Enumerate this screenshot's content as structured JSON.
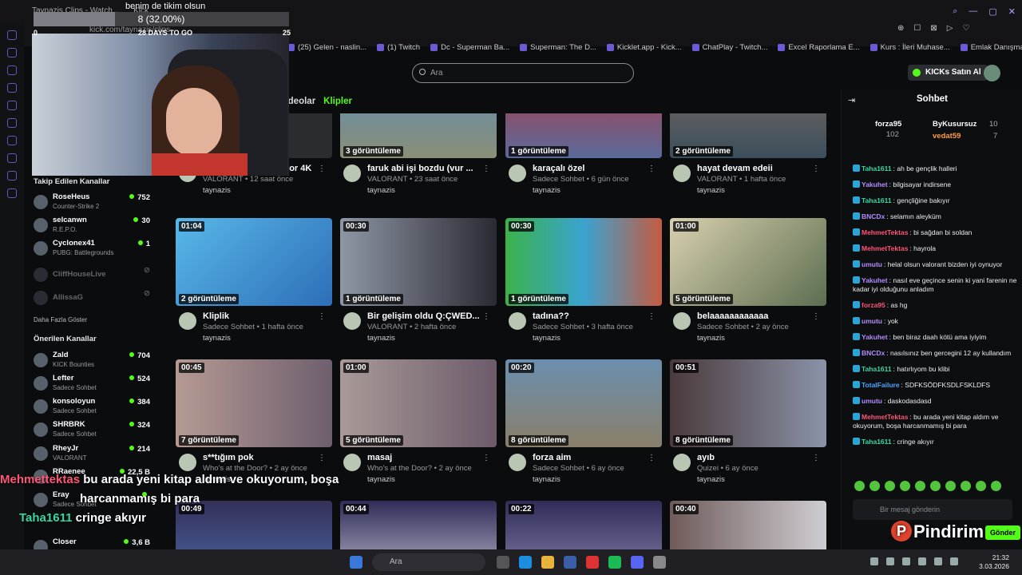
{
  "browser": {
    "url": "kick.com/taynazis/clips",
    "tabs": [
      "Taynazis Clips - Watch...",
      "Kick"
    ],
    "bookmarks": [
      "(25) Gelen - naslin...",
      "(1) Twitch",
      "Dc - Superman Ba...",
      "Superman: The D...",
      "Kicklet.app - Kick...",
      "ChatPlay - Twitch...",
      "Excel Raporlama E...",
      "Kurs : İleri Muhase...",
      "Emlak Danışmanlı..."
    ]
  },
  "goal": {
    "title": "benim de tikim olsun",
    "progress_text": "8 (32.00%)",
    "fraction": 0.32,
    "min": "0",
    "days_left": "28 DAYS TO GO",
    "max": "25"
  },
  "header": {
    "search_placeholder": "Ara",
    "buy_kicks": "KICKs Satın Al"
  },
  "tabs": {
    "videos": "Videolar",
    "clips": "Klipler"
  },
  "sidebar": {
    "followed_title": "Takip Edilen Kanallar",
    "followed": [
      {
        "name": "RoseHeus",
        "game": "Counter-Strike 2",
        "viewers": "752"
      },
      {
        "name": "selcanwn",
        "game": "R.E.P.O.",
        "viewers": "30"
      },
      {
        "name": "Cyclonex41",
        "game": "PUBG: Battlegrounds",
        "viewers": "1"
      },
      {
        "name": "CliffHouseLive",
        "game": "",
        "viewers": ""
      },
      {
        "name": "AllissaG",
        "game": "",
        "viewers": ""
      }
    ],
    "show_more": "Daha Fazla Göster",
    "recommended_title": "Önerilen Kanallar",
    "recommended": [
      {
        "name": "Zald",
        "game": "KICK Bounties",
        "viewers": "704"
      },
      {
        "name": "Lefter",
        "game": "Sadece Sohbet",
        "viewers": "524"
      },
      {
        "name": "konsoloyun",
        "game": "Sadece Sohbet",
        "viewers": "384"
      },
      {
        "name": "SHRBRK",
        "game": "Sadece Sohbet",
        "viewers": "324"
      },
      {
        "name": "RheyJr",
        "game": "VALORANT",
        "viewers": "214"
      },
      {
        "name": "RRaenee",
        "game": "",
        "viewers": "22,5 B"
      },
      {
        "name": "Eray",
        "game": "Sadece Sohbet",
        "viewers": ""
      },
      {
        "name": "",
        "game": "",
        "viewers": ""
      },
      {
        "name": "Closer",
        "game": "",
        "viewers": "3,6 B"
      }
    ]
  },
  "clips": [
    {
      "duration": "",
      "views": "",
      "title": "taynaz skini gösteriyor 4K",
      "meta": "VALORANT • 12 saat önce",
      "author": "taynazis"
    },
    {
      "duration": "",
      "views": "3 görüntüleme",
      "title": "faruk abi işi bozdu (vur ...",
      "meta": "VALORANT • 23 saat önce",
      "author": "taynazis"
    },
    {
      "duration": "",
      "views": "1 görüntüleme",
      "title": "karaçalı özel",
      "meta": "Sadece Sohbet • 6 gün önce",
      "author": "taynazis"
    },
    {
      "duration": "",
      "views": "2 görüntüleme",
      "title": "hayat devam edeii",
      "meta": "VALORANT • 1 hafta önce",
      "author": "taynazis"
    },
    {
      "duration": "01:04",
      "views": "2 görüntüleme",
      "title": "Kliplik",
      "meta": "Sadece Sohbet • 1 hafta önce",
      "author": "taynazis"
    },
    {
      "duration": "00:30",
      "views": "1 görüntüleme",
      "title": "Bir gelişim oldu Q:ÇWED...",
      "meta": "VALORANT • 2 hafta önce",
      "author": "taynazis"
    },
    {
      "duration": "00:30",
      "views": "1 görüntüleme",
      "title": "tadına??",
      "meta": "Sadece Sohbet • 3 hafta önce",
      "author": "taynazis"
    },
    {
      "duration": "01:00",
      "views": "5 görüntüleme",
      "title": "belaaaaaaaaaaaa",
      "meta": "Sadece Sohbet • 2 ay önce",
      "author": "taynazis"
    },
    {
      "duration": "00:45",
      "views": "7 görüntüleme",
      "title": "s**tığım pok",
      "meta": "Who's at the Door? • 2 ay önce",
      "author": "taynazis"
    },
    {
      "duration": "01:00",
      "views": "5 görüntüleme",
      "title": "masaj",
      "meta": "Who's at the Door? • 2 ay önce",
      "author": "taynazis"
    },
    {
      "duration": "00:20",
      "views": "8 görüntüleme",
      "title": "forza aim",
      "meta": "Sadece Sohbet • 6 ay önce",
      "author": "taynazis"
    },
    {
      "duration": "00:51",
      "views": "8 görüntüleme",
      "title": "ayıb",
      "meta": "Quizei • 6 ay önce",
      "author": "taynazis"
    },
    {
      "duration": "00:49",
      "views": "",
      "title": "",
      "meta": "",
      "author": ""
    },
    {
      "duration": "00:44",
      "views": "",
      "title": "",
      "meta": "",
      "author": ""
    },
    {
      "duration": "00:22",
      "views": "",
      "title": "",
      "meta": "",
      "author": ""
    },
    {
      "duration": "00:40",
      "views": "",
      "title": "",
      "meta": "",
      "author": ""
    }
  ],
  "chat": {
    "title": "Sohbet",
    "leaderboard": [
      {
        "name": "forza95",
        "score": "102"
      },
      {
        "name": "ByKusursuz",
        "score": "10"
      },
      {
        "name": "vedat59",
        "score": "7"
      }
    ],
    "messages": [
      {
        "user": "Taha1611",
        "color": "#36d8a2",
        "text": "ah be gençlik halleri"
      },
      {
        "user": "Yakuhet",
        "color": "#b18cff",
        "text": "bilgisayar indirsene"
      },
      {
        "user": "Taha1611",
        "color": "#36d8a2",
        "text": "gençliğine bakıyır"
      },
      {
        "user": "BNCDx",
        "color": "#b18cff",
        "text": "selamın aleyküm"
      },
      {
        "user": "MehmetTektas",
        "color": "#ff5577",
        "text": "bi sağdan bi soldan"
      },
      {
        "user": "MehmetTektas",
        "color": "#ff5577",
        "text": "hayrola"
      },
      {
        "user": "umutu",
        "color": "#b18cff",
        "text": "helal olsun valorant bizden iyi oynuyor"
      },
      {
        "user": "Yakuhet",
        "color": "#b18cff",
        "text": "nasıl eve geçince senin ki yani farenin ne kadar iyi olduğunu anladım"
      },
      {
        "user": "forza95",
        "color": "#ff5577",
        "text": "as hg"
      },
      {
        "user": "umutu",
        "color": "#b18cff",
        "text": "yok"
      },
      {
        "user": "Yakuhet",
        "color": "#b18cff",
        "text": "ben biraz daah kötü ama iyiyim"
      },
      {
        "user": "BNCDx",
        "color": "#b18cff",
        "text": "nasılsınız ben gercegini 12 ay kullandım"
      },
      {
        "user": "Taha1611",
        "color": "#36d8a2",
        "text": "hatırlıyom bu klibi"
      },
      {
        "user": "TotalFailure",
        "color": "#4aa3ff",
        "text": "SDFKSÖDFKSDLFSKLDFS"
      },
      {
        "user": "umutu",
        "color": "#b18cff",
        "text": "daskodasdasd"
      },
      {
        "user": "MehmetTektas",
        "color": "#ff5577",
        "text": "bu arada yeni kitap aldım ve okuyorum, boşa harcanmamış bi para"
      },
      {
        "user": "Taha1611",
        "color": "#36d8a2",
        "text": "cringe akıyır"
      }
    ],
    "input_placeholder": "Bir mesaj gönderin",
    "send": "Gönder"
  },
  "overlay": {
    "line1_user": "Mehmettektas",
    "line1_text": "bu arada yeni kitap aldım ve okuyorum, boşa",
    "line2": "harcanmamış bi para",
    "line3_user": "Taha1611",
    "line3_text": "cringe akıyır",
    "brand": "Pindirim"
  },
  "taskbar": {
    "search": "Ara",
    "time": "21:32",
    "date": "3.03.2026"
  }
}
